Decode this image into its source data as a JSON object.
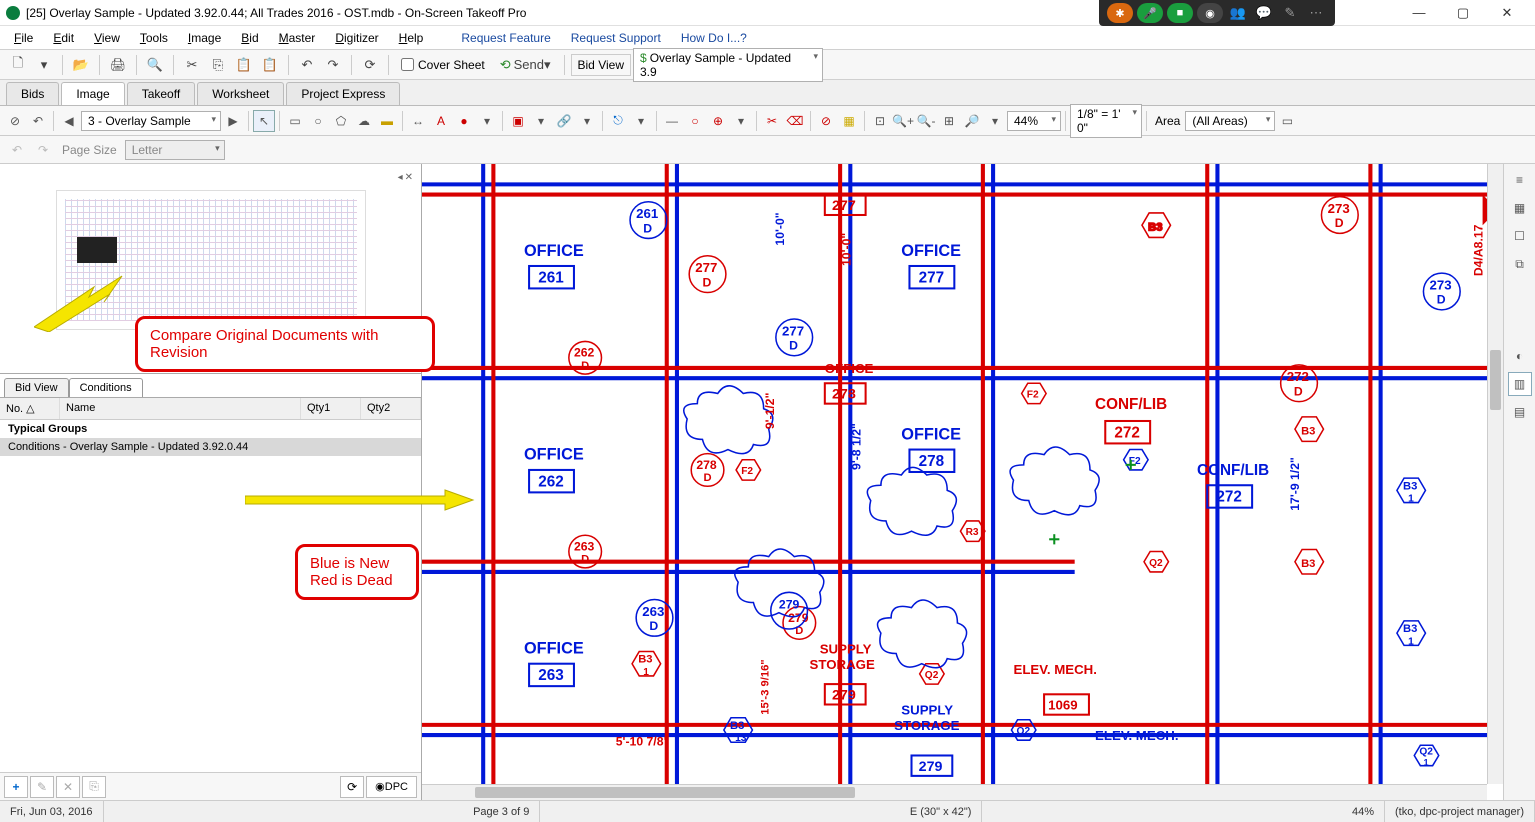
{
  "window": {
    "title": "[25] Overlay Sample - Updated 3.92.0.44; All Trades 2016 - OST.mdb - On-Screen Takeoff Pro"
  },
  "menu": {
    "file": "File",
    "edit": "Edit",
    "view": "View",
    "tools": "Tools",
    "image": "Image",
    "bid": "Bid",
    "master": "Master",
    "digitizer": "Digitizer",
    "help": "Help",
    "req_feature": "Request Feature",
    "req_support": "Request Support",
    "howdo": "How Do I...?"
  },
  "toolbar": {
    "cover_sheet": "Cover Sheet",
    "send": "Send",
    "bid_view": "Bid View",
    "doc_tab": "Overlay Sample - Updated 3.9"
  },
  "tabs": {
    "bids": "Bids",
    "image": "Image",
    "takeoff": "Takeoff",
    "worksheet": "Worksheet",
    "project_express": "Project Express"
  },
  "img_toolbar": {
    "page_nav": "3 - Overlay Sample",
    "zoom": "44%",
    "scale": "1/8\" = 1' 0\"",
    "area_label": "Area",
    "area_value": "(All Areas)"
  },
  "pagesize": {
    "label": "Page Size",
    "value": "Letter"
  },
  "left_tabs": {
    "bidview": "Bid View",
    "conditions": "Conditions"
  },
  "cond_table": {
    "col_no": "No.",
    "col_name": "Name",
    "col_q1": "Qty1",
    "col_q2": "Qty2",
    "group": "Typical Groups",
    "row": "Conditions - Overlay Sample - Updated 3.92.0.44"
  },
  "dpc": "DPC",
  "status": {
    "date": "Fri, Jun 03, 2016",
    "page": "Page 3 of 9",
    "dims": "E (30\" x 42\")",
    "zoom": "44%",
    "user": "(tko, dpc-project manager)"
  },
  "callouts": {
    "compare": "Compare Original Documents with Revision",
    "legend_l1": "Blue is New",
    "legend_l2": "Red is Dead"
  },
  "blueprint": {
    "rooms": {
      "off261": "OFFICE",
      "n261": "261",
      "off262": "OFFICE",
      "n262": "262",
      "off263": "OFFICE",
      "n263": "263",
      "off277": "OFFICE",
      "n277": "277",
      "off278": "OFFICE",
      "n278": "278",
      "n279": "279",
      "conflib": "CONF/LIB",
      "n272": "272",
      "n273": "273",
      "supply": "SUPPLY",
      "storage": "STORAGE",
      "elevmech": "ELEV. MECH.",
      "n1069": "1069"
    },
    "tags": {
      "d261": "261",
      "d262": "262",
      "d263": "263",
      "d277": "277",
      "d277b": "277",
      "d278": "278",
      "d279": "279",
      "d279b": "279",
      "d272": "272",
      "d273": "273",
      "sub_d": "D",
      "f2": "F2",
      "r3": "R3",
      "q2": "Q2",
      "b3": "B3",
      "b3_1": "1",
      "h_10_0": "10'-0\"",
      "h_9_8": "9'-8 1/2\"",
      "h_9_1": "9'-1/2\"",
      "h_17_9": "17'-9 1/2\"",
      "dim1": "5'-10 7/8\"",
      "dim2": "15'-3 9/16\"",
      "dim3": "D4/A8.17"
    }
  }
}
